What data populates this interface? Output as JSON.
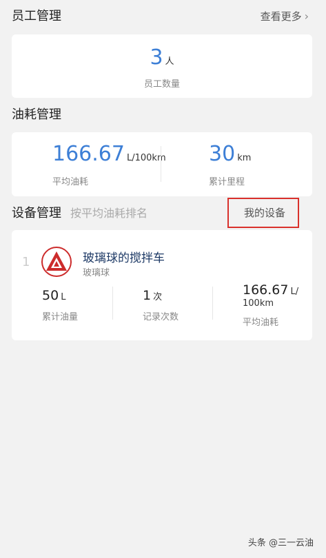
{
  "employee": {
    "title": "员工管理",
    "link": "查看更多",
    "count": "3",
    "unit": "人",
    "caption": "员工数量"
  },
  "fuel": {
    "title": "油耗管理",
    "avg_value": "166.67",
    "avg_unit": "L/100km",
    "avg_caption": "平均油耗",
    "distance_value": "30",
    "distance_unit": "km",
    "distance_caption": "累计里程"
  },
  "devices": {
    "title": "设备管理",
    "subtitle": "按平均油耗排名",
    "my_devices": "我的设备(1)",
    "item": {
      "rank": "1",
      "name": "玻璃球的搅拌车",
      "owner": "玻璃球",
      "stat1_value": "50",
      "stat1_unit": "L",
      "stat1_caption": "累计油量",
      "stat2_value": "1",
      "stat2_unit": "次",
      "stat2_caption": "记录次数",
      "stat3_value": "166.67",
      "stat3_unit_line1": "L/",
      "stat3_unit_line2": "100km",
      "stat3_caption": "平均油耗"
    }
  },
  "watermark": "头条 @三一云油",
  "colors": {
    "accent": "#3d7fd6",
    "highlight_border": "#d9302b",
    "logo_red": "#cc2b2b"
  },
  "icons": {
    "chevron": "chevron-right-icon",
    "logo": "sany-logo-icon"
  }
}
